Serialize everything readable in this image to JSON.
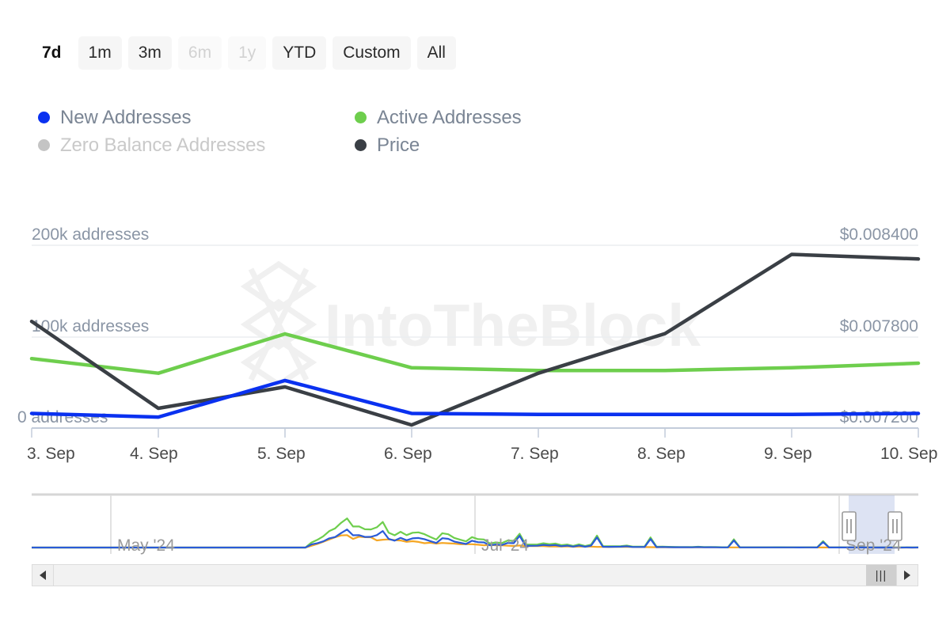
{
  "range_selector": {
    "options": [
      {
        "label": "7d",
        "state": "selected"
      },
      {
        "label": "1m",
        "state": "normal"
      },
      {
        "label": "3m",
        "state": "normal"
      },
      {
        "label": "6m",
        "state": "disabled"
      },
      {
        "label": "1y",
        "state": "disabled"
      },
      {
        "label": "YTD",
        "state": "normal"
      },
      {
        "label": "Custom",
        "state": "normal"
      },
      {
        "label": "All",
        "state": "normal"
      }
    ]
  },
  "legend": {
    "items": [
      {
        "label": "New Addresses",
        "color": "#0a31f0",
        "active": true,
        "column": 1
      },
      {
        "label": "Active Addresses",
        "color": "#6ece4d",
        "active": true,
        "column": 2
      },
      {
        "label": "Zero Balance Addresses",
        "color": "#c4c4c4",
        "active": false,
        "column": 1
      },
      {
        "label": "Price",
        "color": "#3a3f45",
        "active": true,
        "column": 2
      }
    ]
  },
  "watermark": {
    "text": "IntoTheBlock"
  },
  "chart_data": {
    "type": "line",
    "title": "",
    "xlabel": "",
    "ylabel": "addresses",
    "x": [
      "3. Sep",
      "4. Sep",
      "5. Sep",
      "6. Sep",
      "7. Sep",
      "8. Sep",
      "9. Sep",
      "10. Sep"
    ],
    "left_axis": {
      "label": "addresses",
      "ticks": [
        "0 addresses",
        "100k addresses",
        "200k addresses"
      ],
      "tick_values": [
        0,
        100000,
        200000
      ],
      "ylim": [
        0,
        230000
      ]
    },
    "right_axis": {
      "label": "Price",
      "ticks": [
        "$0.007200",
        "$0.007800",
        "$0.008400"
      ],
      "tick_values": [
        0.0072,
        0.0078,
        0.0084
      ],
      "ylim": [
        0.00705,
        0.0087
      ]
    },
    "grid": true,
    "legend_position": "top-left",
    "series": [
      {
        "name": "New Addresses",
        "color": "#0a31f0",
        "axis": "left",
        "unit": "addresses",
        "values": [
          16000,
          12000,
          52000,
          16000,
          15000,
          15000,
          15000,
          16000
        ]
      },
      {
        "name": "Active Addresses",
        "color": "#6ece4d",
        "axis": "left",
        "unit": "addresses",
        "values": [
          76000,
          60000,
          103000,
          66000,
          63000,
          63000,
          66000,
          71000
        ]
      },
      {
        "name": "Price",
        "color": "#3a3f45",
        "axis": "right",
        "unit": "USD",
        "values": [
          0.0079,
          0.00733,
          0.00747,
          0.00722,
          0.00756,
          0.00782,
          0.00834,
          0.00831
        ]
      }
    ]
  },
  "navigator": {
    "month_labels": [
      "May '24",
      "Jul '24",
      "Sep '24"
    ],
    "selection": {
      "from": "Sep '24",
      "to": "Sep '24"
    },
    "series": [
      {
        "name": "Active Addresses",
        "color": "#6ece4d"
      },
      {
        "name": "New Addresses",
        "color": "#2a5bd7"
      },
      {
        "name": "Zero Balance Addresses",
        "color": "#f5a623"
      }
    ],
    "handle_grip": "‖"
  },
  "scrollbar": {
    "left_arrow": "◀",
    "right_arrow": "▶",
    "thumb_grip": "|||"
  }
}
